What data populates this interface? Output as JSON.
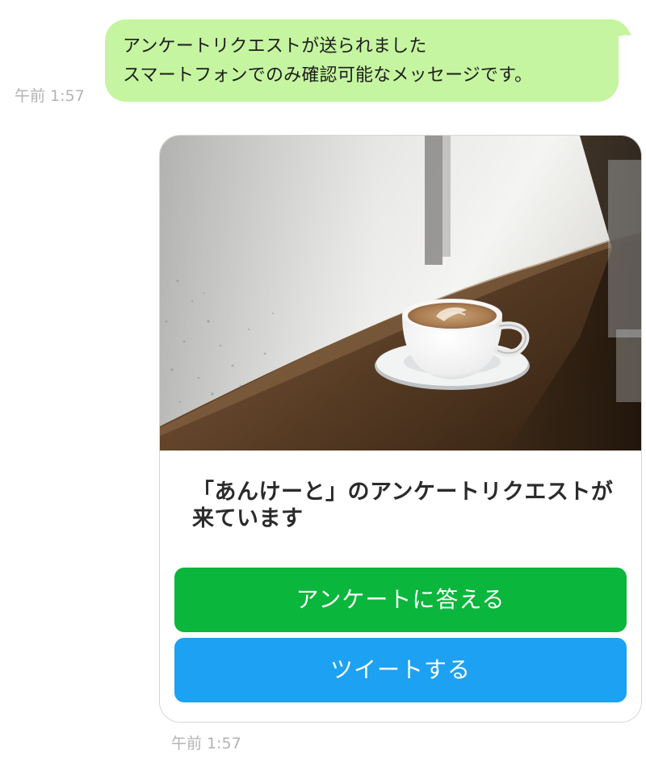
{
  "message_1": {
    "lines": [
      "アンケートリクエストが送られました",
      "スマートフォンでのみ確認可能なメッセージです。"
    ],
    "time": "午前 1:57",
    "bubble_color": "#c5f5a0"
  },
  "card": {
    "image": "coffee-cup-photo",
    "title": "「あんけーと」のアンケートリクエストが来ています",
    "buttons": {
      "answer_label": "アンケートに答える",
      "answer_color": "#0ab63c",
      "tweet_label": "ツイートする",
      "tweet_color": "#1da1f2"
    },
    "time": "午前 1:57"
  }
}
